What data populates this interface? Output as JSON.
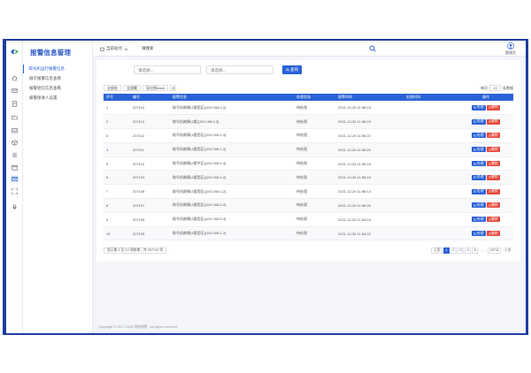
{
  "brand": {
    "accent": "#2a62d6",
    "frame": "#1f3da1",
    "danger": "#e8483a"
  },
  "rail": {
    "icons": [
      "home-icon",
      "mail-icon",
      "document-icon",
      "folder-icon",
      "inbox-icon",
      "cube-icon",
      "list-icon",
      "calendar-icon",
      "message-icon",
      "expand-icon",
      "microphone-icon"
    ],
    "active_index": 8
  },
  "nav": {
    "title": "报警信息管理",
    "items": [
      {
        "label": "取号机运行报警信息",
        "active": true
      },
      {
        "label": "展示报警信息查看",
        "active": false
      },
      {
        "label": "报警短信信息查看",
        "active": false
      },
      {
        "label": "报警接收人设置",
        "active": false
      }
    ]
  },
  "header": {
    "scope_label": "当前站点",
    "search_value": "请搜索",
    "user_name": "管理员"
  },
  "filters": {
    "placeholder_1": "请选择...",
    "placeholder_2": "请选择...",
    "query_label": "查询"
  },
  "toolbar": {
    "buttons": [
      "全部处",
      "全部删",
      "导出到excel"
    ],
    "page_size_label": "每页",
    "page_size_value": "10",
    "page_size_suffix": "条数据"
  },
  "table": {
    "columns": [
      "序号",
      "编号",
      "报警信息",
      "处理状态",
      "报警时间",
      "处理时间",
      "操作"
    ],
    "rows": [
      [
        "1",
        "207114",
        "取号机故障(1楼西区)[192.168.0.2]",
        "待处理",
        "2021-12-26 11:56:24",
        ""
      ],
      [
        "2",
        "207113",
        "取号机故障(1楼)[192.168.0.3]",
        "待处理",
        "2021-12-26 11:56:24",
        ""
      ],
      [
        "3",
        "207112",
        "取号机故障(1楼西区)[192.168.1.4]",
        "待处理",
        "2021-12-26 11:56:22",
        ""
      ],
      [
        "4",
        "207111",
        "取号机故障(1楼西区)[192.168.1.2]",
        "待处理",
        "2021-12-26 11:56:20",
        ""
      ],
      [
        "5",
        "207110",
        "取号机故障(2楼中区)[192.168.1.4]",
        "待处理",
        "2021-12-26 11:56:18",
        ""
      ],
      [
        "6",
        "207109",
        "取号机故障(1楼西区)[192.168.1.2]",
        "待处理",
        "2021-12-26 11:56:18",
        ""
      ],
      [
        "7",
        "207108",
        "取号机故障(1楼西区)[192.168.2.2]",
        "待处理",
        "2021-12-26 11:56:14",
        ""
      ],
      [
        "8",
        "207107",
        "取号机故障(1楼西区)[192.168.0.2]",
        "待处理",
        "2021-12-26 11:56:26",
        ""
      ],
      [
        "9",
        "207106",
        "取号机故障(1楼西区)[192.168.0.3]",
        "待处理",
        "2021-12-26 11:54:24",
        ""
      ],
      [
        "10",
        "207105",
        "取号机故障(1楼西区)[192.168.1.2]",
        "待处理",
        "2021-12-26 11:54:22",
        ""
      ]
    ],
    "action_handle": "处理",
    "action_delete": "删除"
  },
  "pagination": {
    "summary": "显示第 1 至 10 项结果，共 207112 项",
    "prev": "上页",
    "pages": [
      "1",
      "2",
      "3",
      "4",
      "5",
      "…",
      "20711"
    ],
    "next": "下页",
    "current": "1"
  },
  "footer": {
    "copyright": "Copyright © 2017-2018 领航微警 , All rights reserved."
  }
}
